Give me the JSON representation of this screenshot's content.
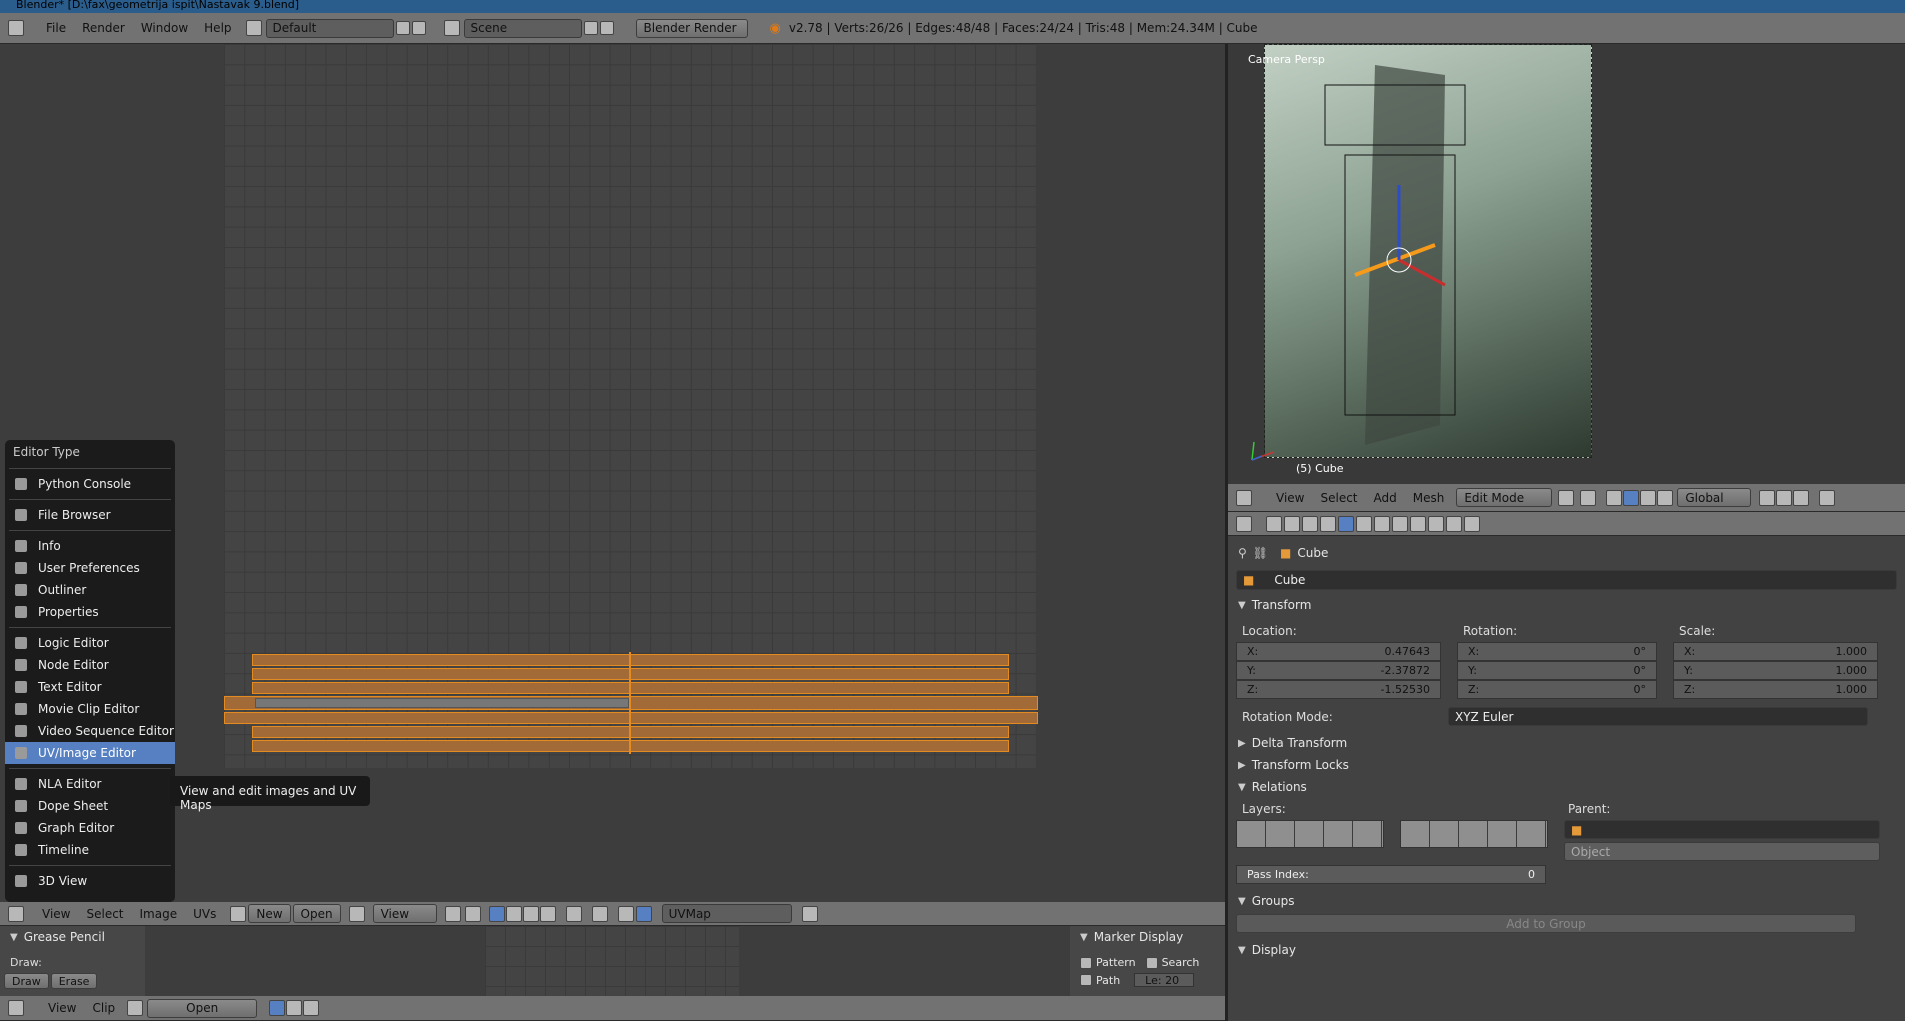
{
  "window": {
    "title": "Blender* [D:\\fax\\geometrija ispit\\Nastavak 9.blend]"
  },
  "topbar": {
    "menus": [
      "File",
      "Render",
      "Window",
      "Help"
    ],
    "layout": "Default",
    "scene": "Scene",
    "engine": "Blender Render",
    "stats": "v2.78 | Verts:26/26 | Edges:48/48 | Faces:24/24 | Tris:48 | Mem:24.34M | Cube"
  },
  "editor_menu": {
    "title": "Editor Type",
    "items": [
      {
        "label": "Python Console",
        "icon": "python-console-icon"
      },
      {
        "label": "File Browser",
        "icon": "file-browser-icon"
      },
      {
        "label": "Info",
        "icon": "info-icon"
      },
      {
        "label": "User Preferences",
        "icon": "preferences-icon"
      },
      {
        "label": "Outliner",
        "icon": "outliner-icon"
      },
      {
        "label": "Properties",
        "icon": "properties-icon"
      },
      {
        "label": "Logic Editor",
        "icon": "logic-icon"
      },
      {
        "label": "Node Editor",
        "icon": "node-icon"
      },
      {
        "label": "Text Editor",
        "icon": "text-icon"
      },
      {
        "label": "Movie Clip Editor",
        "icon": "clip-icon"
      },
      {
        "label": "Video Sequence Editor",
        "icon": "sequence-icon"
      },
      {
        "label": "UV/Image Editor",
        "icon": "image-icon"
      },
      {
        "label": "NLA Editor",
        "icon": "nla-icon"
      },
      {
        "label": "Dope Sheet",
        "icon": "dopesheet-icon"
      },
      {
        "label": "Graph Editor",
        "icon": "graph-icon"
      },
      {
        "label": "Timeline",
        "icon": "timeline-icon"
      },
      {
        "label": "3D View",
        "icon": "view3d-icon"
      }
    ],
    "tooltip": "View and edit images and UV Maps"
  },
  "uv_header": {
    "menus": [
      "View",
      "Select",
      "Image",
      "UVs"
    ],
    "new_label": "New",
    "open_label": "Open",
    "view_label": "View",
    "uvmap": "UVMap"
  },
  "grease_pencil": {
    "title": "Grease Pencil",
    "draw_label": "Draw:",
    "draw": "Draw",
    "erase": "Erase"
  },
  "marker_display": {
    "title": "Marker Display",
    "pattern": "Pattern",
    "search": "Search",
    "path": "Path",
    "len": "Le: 20"
  },
  "timeline_header": {
    "menus": [
      "View",
      "Clip"
    ],
    "open_label": "Open"
  },
  "viewport": {
    "label": "Camera Persp",
    "object": "(5) Cube"
  },
  "view3d_header": {
    "menus": [
      "View",
      "Select",
      "Add",
      "Mesh"
    ],
    "mode": "Edit Mode",
    "orientation": "Global"
  },
  "properties": {
    "breadcrumb": "Cube",
    "object_name": "Cube",
    "transform_title": "Transform",
    "location_label": "Location:",
    "rotation_label": "Rotation:",
    "scale_label": "Scale:",
    "location": [
      {
        "axis": "X:",
        "value": "0.47643"
      },
      {
        "axis": "Y:",
        "value": "-2.37872"
      },
      {
        "axis": "Z:",
        "value": "-1.52530"
      }
    ],
    "rotation": [
      {
        "axis": "X:",
        "value": "0°"
      },
      {
        "axis": "Y:",
        "value": "0°"
      },
      {
        "axis": "Z:",
        "value": "0°"
      }
    ],
    "scale": [
      {
        "axis": "X:",
        "value": "1.000"
      },
      {
        "axis": "Y:",
        "value": "1.000"
      },
      {
        "axis": "Z:",
        "value": "1.000"
      }
    ],
    "rotation_mode_label": "Rotation Mode:",
    "rotation_mode": "XYZ Euler",
    "delta_transform": "Delta Transform",
    "transform_locks": "Transform Locks",
    "relations": "Relations",
    "layers_label": "Layers:",
    "parent_label": "Parent:",
    "parent_type": "Object",
    "pass_index_label": "Pass Index:",
    "pass_index": "0",
    "groups": "Groups",
    "add_to_group": "Add to Group",
    "display": "Display"
  }
}
